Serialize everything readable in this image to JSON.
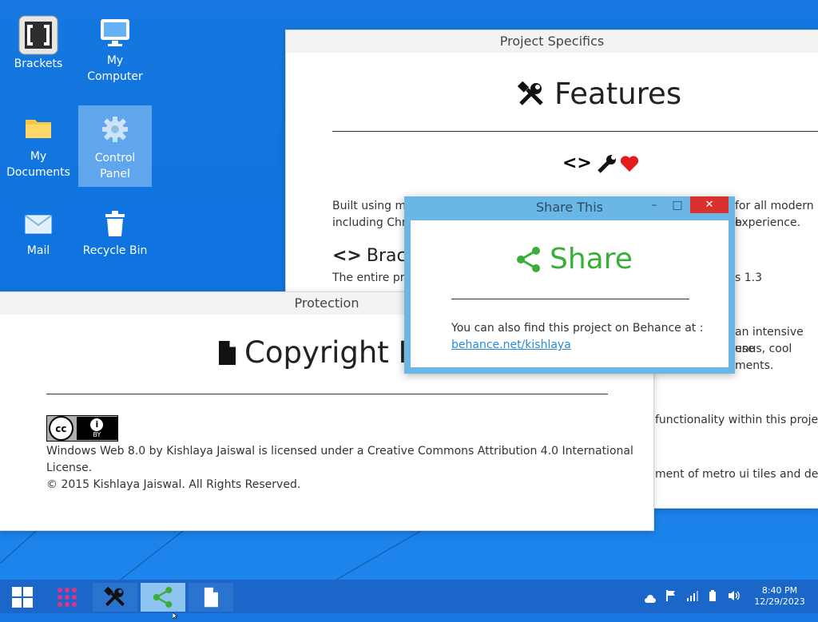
{
  "desktop": {
    "icons": [
      {
        "label": "Brackets",
        "icon": "brackets-icon"
      },
      {
        "label": "My Computer",
        "icon": "monitor-icon"
      },
      {
        "label": "My Documents",
        "icon": "folder-icon"
      },
      {
        "label": "Control Panel",
        "icon": "gear-icon"
      },
      {
        "label": "Mail",
        "icon": "mail-icon"
      },
      {
        "label": "Recycle Bin",
        "icon": "trash-icon"
      }
    ]
  },
  "project_window": {
    "title": "Project Specifics",
    "heading": "Features",
    "heading_icon": "tools-icon",
    "symbols": "<>",
    "intro_a": "Built using mo",
    "intro_b": "including Chro",
    "right_a": "for all modern b",
    "right_b": "experience.",
    "brackets_heading": "Bracke",
    "entire_text": "The entire pro",
    "version_text": "s 1.3",
    "mid_a": "an intensive use",
    "mid_b": "enus, cool",
    "mid_c": "ments.",
    "functionality_text": "functionality within this project",
    "metro_text": "ment of metro ui tiles and deskt"
  },
  "protection_window": {
    "title": "Protection",
    "heading": "Copyright In",
    "heading_icon": "document-icon",
    "cc_badge": {
      "cc": "cc",
      "by": "BY"
    },
    "license_line1": "Windows Web 8.0 by Kishlaya Jaiswal is licensed under a Creative Commons Attribution 4.0 International",
    "license_line2": "License.",
    "copyright": "© 2015 Kishlaya Jaiswal. All Rights Reserved."
  },
  "share_dialog": {
    "title": "Share This",
    "heading": "Share",
    "heading_icon": "share-icon",
    "body_text": "You can also find this project on Behance at :",
    "link_text": "behance.net/kishlaya",
    "controls": {
      "minimize": "–",
      "maximize": "□",
      "close": "✕"
    },
    "colors": {
      "accent": "#3aae3a",
      "frame": "#6ab7e6",
      "close": "#d9312d"
    }
  },
  "taskbar": {
    "buttons": [
      "start-icon",
      "apps-grid-icon",
      "tools-icon",
      "share-icon",
      "document-icon"
    ],
    "clock_time": "8:40 PM",
    "clock_date": "12/29/2023"
  }
}
